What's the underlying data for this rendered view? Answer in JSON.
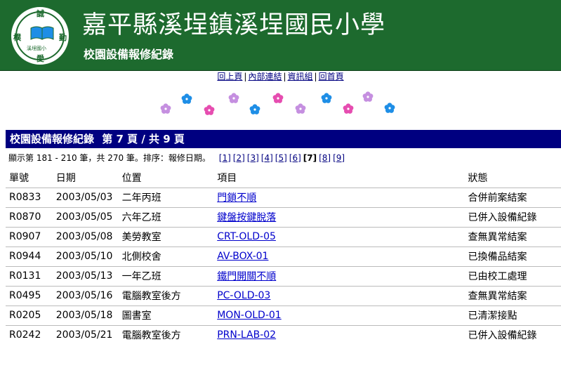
{
  "header": {
    "title": "嘉平縣溪埕鎮溪埕國民小學",
    "subtitle": "校園設備報修紀錄",
    "logo": {
      "top": "誠",
      "left": "樸",
      "right": "勤",
      "bottom": "愛",
      "caption": "溪埕國小"
    }
  },
  "nav": [
    "回上頁",
    "內部連結",
    "資訊組",
    "回首頁"
  ],
  "list_bar": {
    "label": "校園設備報修紀錄",
    "page_info": "第 7 頁 / 共 9 頁"
  },
  "summary": {
    "text": "顯示第 181 - 210 筆，共 270 筆。排序：報修日期。",
    "pages": [
      "[1]",
      "[2]",
      "[3]",
      "[4]",
      "[5]",
      "[6]"
    ],
    "current_page": "[7]",
    "pages_after": [
      "[8]",
      "[9]"
    ]
  },
  "table": {
    "headers": [
      "單號",
      "日期",
      "位置",
      "項目",
      "狀態"
    ],
    "rows": [
      [
        "R0833",
        "2003/05/03",
        "二年丙班",
        "門鎖不順",
        "合併前案結案"
      ],
      [
        "R0870",
        "2003/05/05",
        "六年乙班",
        "鍵盤按鍵脫落",
        "已併入設備紀錄"
      ],
      [
        "R0907",
        "2003/05/08",
        "美勞教室",
        "CRT-OLD-05",
        "查無異常結案"
      ],
      [
        "R0944",
        "2003/05/10",
        "北側校舍",
        "AV-BOX-01",
        "已換備品結案"
      ],
      [
        "R0131",
        "2003/05/13",
        "一年乙班",
        "鐵門開關不順",
        "已由校工處理"
      ],
      [
        "R0495",
        "2003/05/16",
        "電腦教室後方",
        "PC-OLD-03",
        "查無異常結案"
      ],
      [
        "R0205",
        "2003/05/18",
        "圖書室",
        "MON-OLD-01",
        "已清潔接點"
      ],
      [
        "R0242",
        "2003/05/21",
        "電腦教室後方",
        "PRN-LAB-02",
        "已併入設備紀錄"
      ]
    ]
  },
  "colors": {
    "header_bg": "#1d6a2e",
    "bar_bg": "#000080",
    "link": "#0000cc",
    "flower_pink": "#e64db0",
    "flower_blue": "#1e8ee6",
    "flower_violet": "#c58fe0"
  },
  "icons": {
    "logo": "school-emblem-icon",
    "flower": "flower-icon"
  }
}
